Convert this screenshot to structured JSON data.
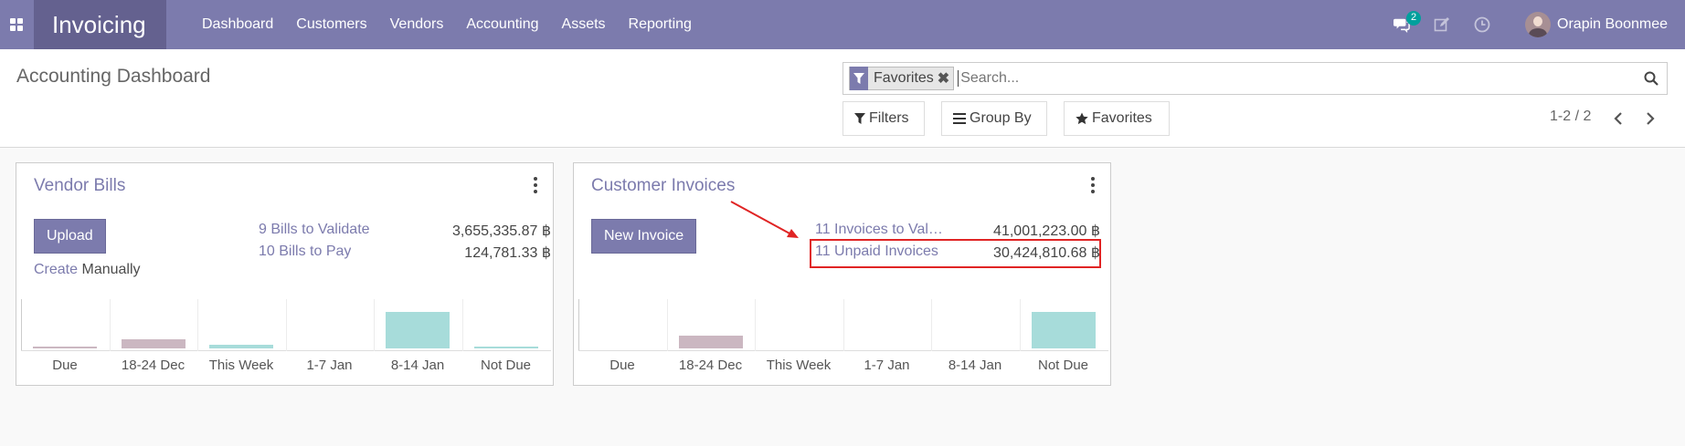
{
  "navbar": {
    "app_title": "Invoicing",
    "menu": [
      "Dashboard",
      "Customers",
      "Vendors",
      "Accounting",
      "Assets",
      "Reporting"
    ],
    "messages_badge": "2",
    "user_name": "Orapin Boonmee",
    "bg_color": "#7c7bad"
  },
  "control_panel": {
    "title": "Accounting Dashboard",
    "facet_label": "Favorites",
    "search_placeholder": "Search...",
    "filters_label": "Filters",
    "group_by_label": "Group By",
    "favorites_label": "Favorites",
    "pager": "1-2 / 2"
  },
  "vendor_bills": {
    "title": "Vendor Bills",
    "upload_label": "Upload",
    "create_link": "Create",
    "create_suffix": "Manually",
    "stats": [
      {
        "label": "9 Bills to Validate",
        "value": "3,655,335.87 ฿"
      },
      {
        "label": "10 Bills to Pay",
        "value": "124,781.33 ฿"
      }
    ]
  },
  "customer_invoices": {
    "title": "Customer Invoices",
    "new_invoice_label": "New Invoice",
    "stats": [
      {
        "label": "11 Invoices to Val…",
        "value": "41,001,223.00 ฿"
      },
      {
        "label": "11 Unpaid Invoices",
        "value": "30,424,810.68 ฿"
      }
    ]
  },
  "chart_data": [
    {
      "type": "bar",
      "categories": [
        "Due",
        "18-24 Dec",
        "This Week",
        "1-7 Jan",
        "8-14 Jan",
        "Not Due"
      ],
      "values": [
        0.05,
        0.25,
        0.1,
        0,
        1.0,
        0.02
      ],
      "colors": [
        "#cbb7c1",
        "#cbb7c1",
        "#a7dcda",
        "#a7dcda",
        "#a7dcda",
        "#a7dcda"
      ]
    },
    {
      "type": "bar",
      "categories": [
        "Due",
        "18-24 Dec",
        "This Week",
        "1-7 Jan",
        "8-14 Jan",
        "Not Due"
      ],
      "values": [
        0,
        0.35,
        0,
        0,
        0,
        1.0
      ],
      "colors": [
        "#cbb7c1",
        "#cbb7c1",
        "#a7dcda",
        "#a7dcda",
        "#a7dcda",
        "#a7dcda"
      ]
    }
  ],
  "colors": {
    "accent": "#7c7bad",
    "highlight": "#e02424"
  }
}
